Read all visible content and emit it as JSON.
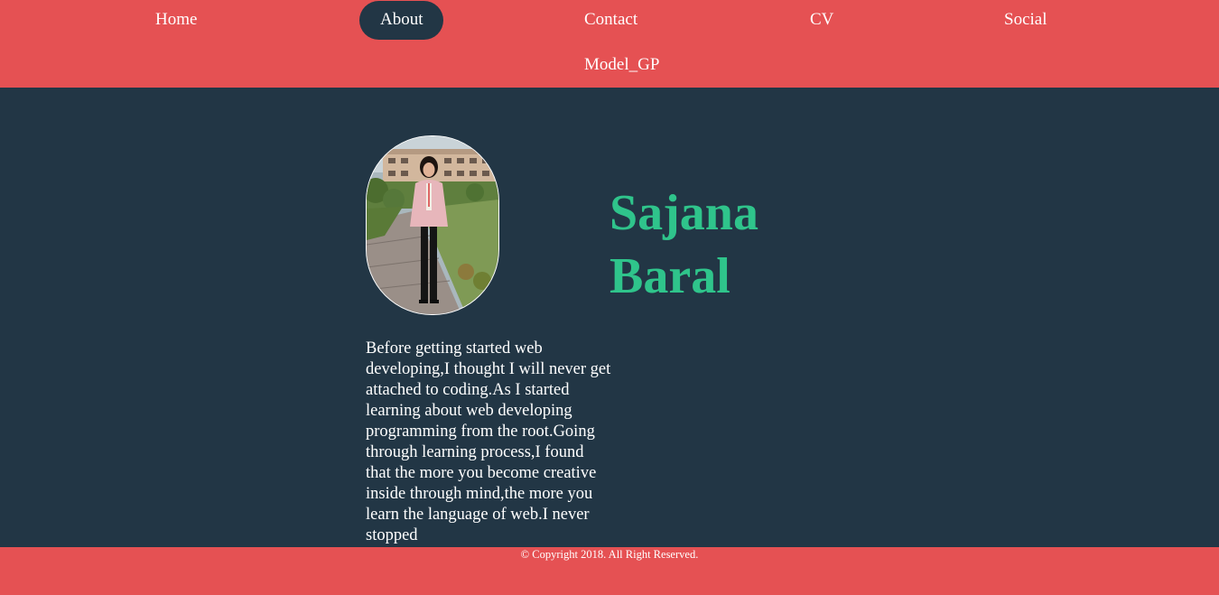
{
  "nav": {
    "items": [
      {
        "label": "Home"
      },
      {
        "label": "About"
      },
      {
        "label": "Contact"
      },
      {
        "label": "CV"
      },
      {
        "label": "Social"
      },
      {
        "label": "Model_GP"
      }
    ],
    "active": "About"
  },
  "profile": {
    "name_first": "Sajana",
    "name_last": "Baral",
    "photo_icon": "profile-photo",
    "bio": "Before getting started web developing,I thought I will never get attached to coding.As I started learning about web developing programming from the root.Going through learning process,I found that the more you become creative inside through mind,the more you learn the language of web.I never stopped"
  },
  "footer": {
    "copyright": "© Copyright 2018. All Right Reserved."
  },
  "colors": {
    "nav_bg": "#e55153",
    "page_bg": "#223645",
    "name_color": "#2fc48b",
    "text": "#ffffff"
  }
}
